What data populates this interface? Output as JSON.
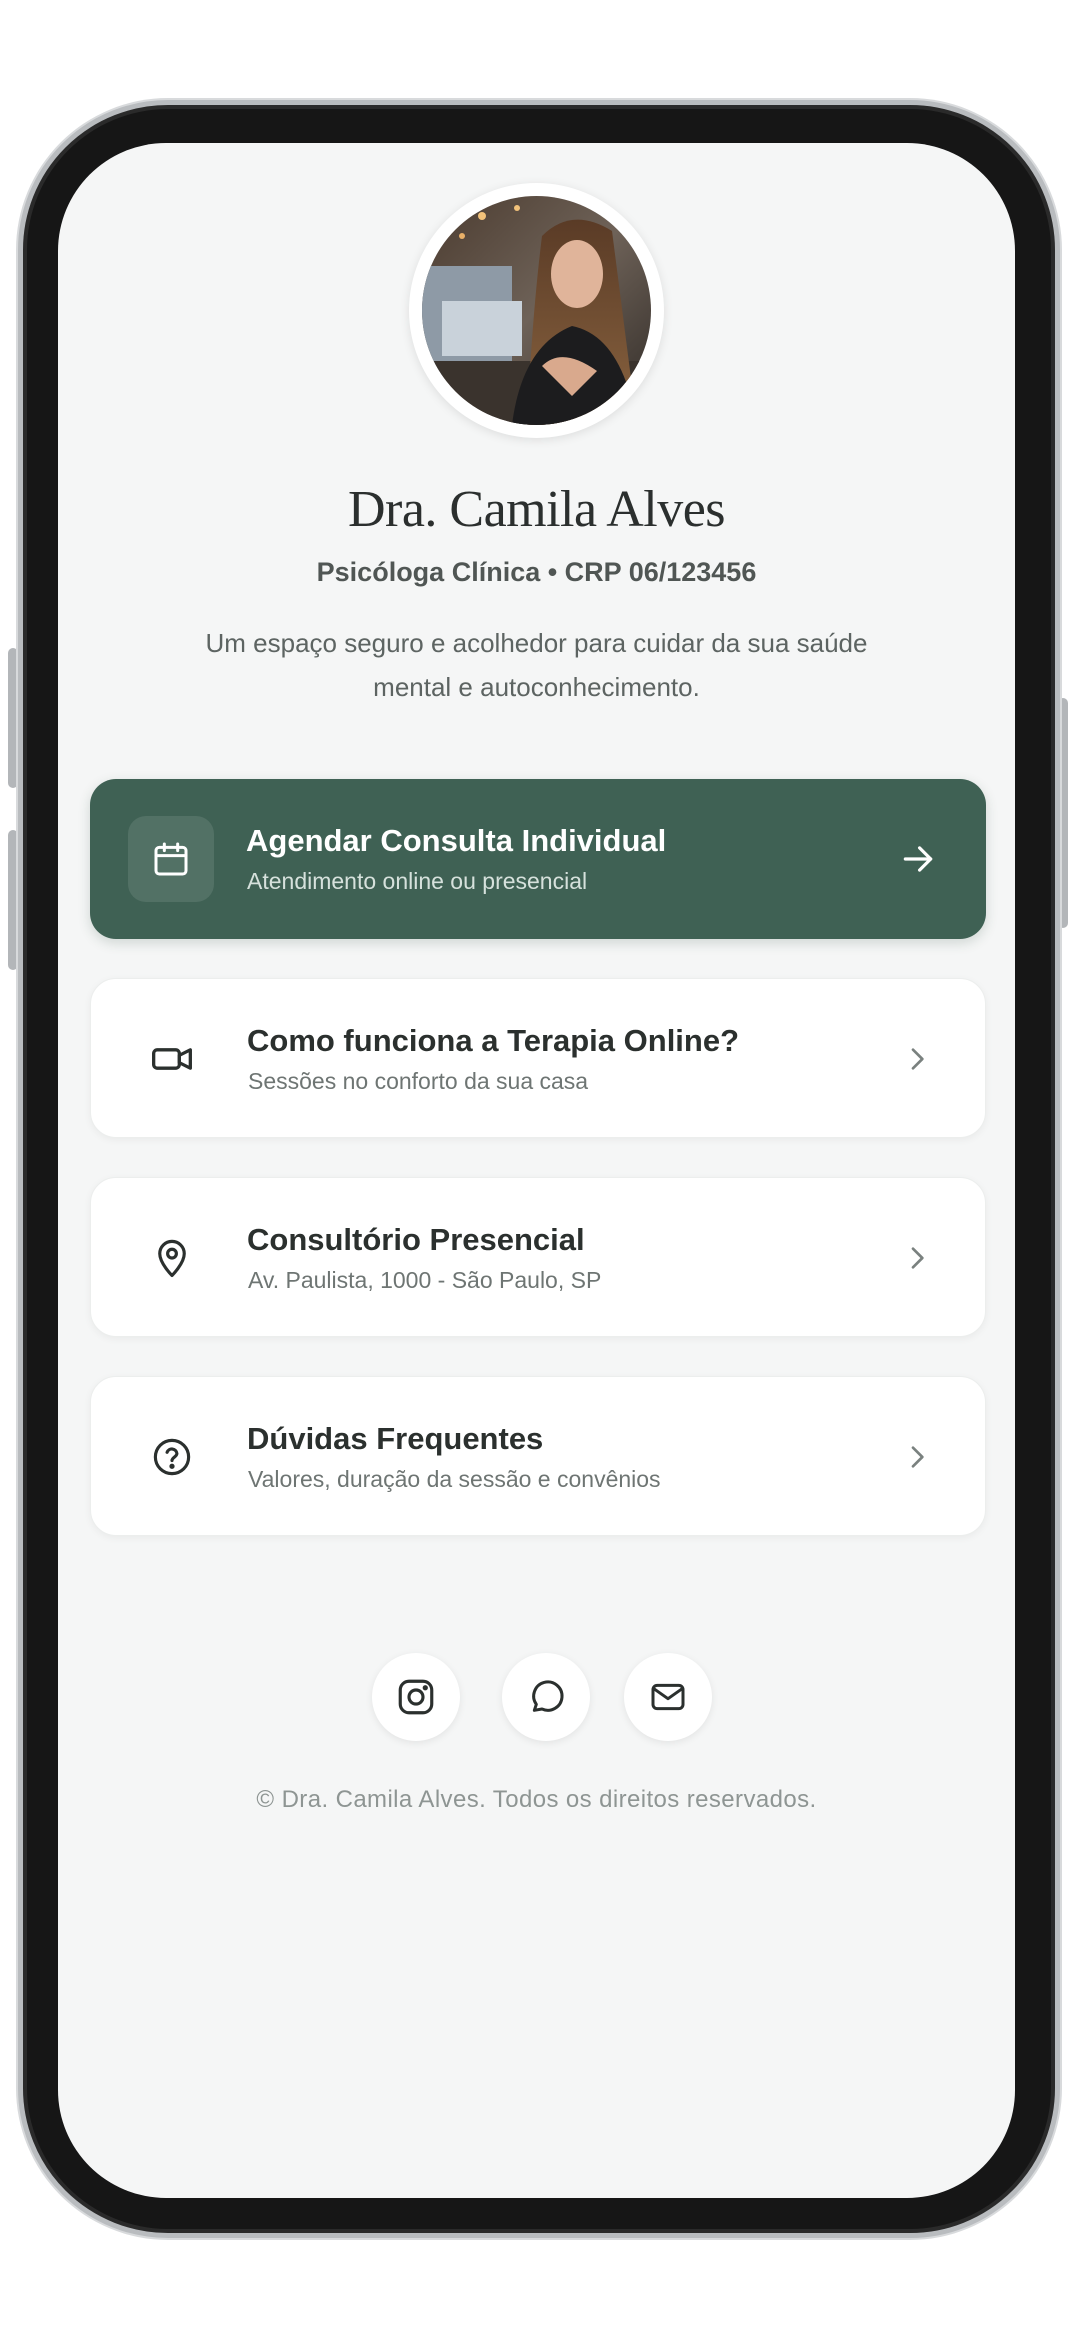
{
  "profile": {
    "name": "Dra. Camila Alves",
    "credential": "Psicóloga Clínica • CRP 06/123456",
    "bio": "Um espaço seguro e acolhedor para cuidar da sua saúde mental e autoconhecimento."
  },
  "links": [
    {
      "title": "Agendar Consulta Individual",
      "subtitle": "Atendimento online ou presencial",
      "icon": "calendar-icon",
      "trail_icon": "arrow-right-icon"
    },
    {
      "title": "Como funciona a Terapia Online?",
      "subtitle": "Sessões no conforto da sua casa",
      "icon": "video-camera-icon",
      "trail_icon": "chevron-right-icon"
    },
    {
      "title": "Consultório Presencial",
      "subtitle": "Av. Paulista, 1000 - São Paulo, SP",
      "icon": "map-pin-icon",
      "trail_icon": "chevron-right-icon"
    },
    {
      "title": "Dúvidas Frequentes",
      "subtitle": "Valores, duração da sessão e convênios",
      "icon": "help-circle-icon",
      "trail_icon": "chevron-right-icon"
    }
  ],
  "social": [
    {
      "icon": "instagram-icon"
    },
    {
      "icon": "whatsapp-icon"
    },
    {
      "icon": "mail-icon"
    }
  ],
  "footer": "© Dra. Camila Alves. Todos os direitos reservados.",
  "colors": {
    "primary": "#3f6154",
    "background": "#f5f6f6",
    "card": "#ffffff",
    "text": "#2b302e"
  }
}
